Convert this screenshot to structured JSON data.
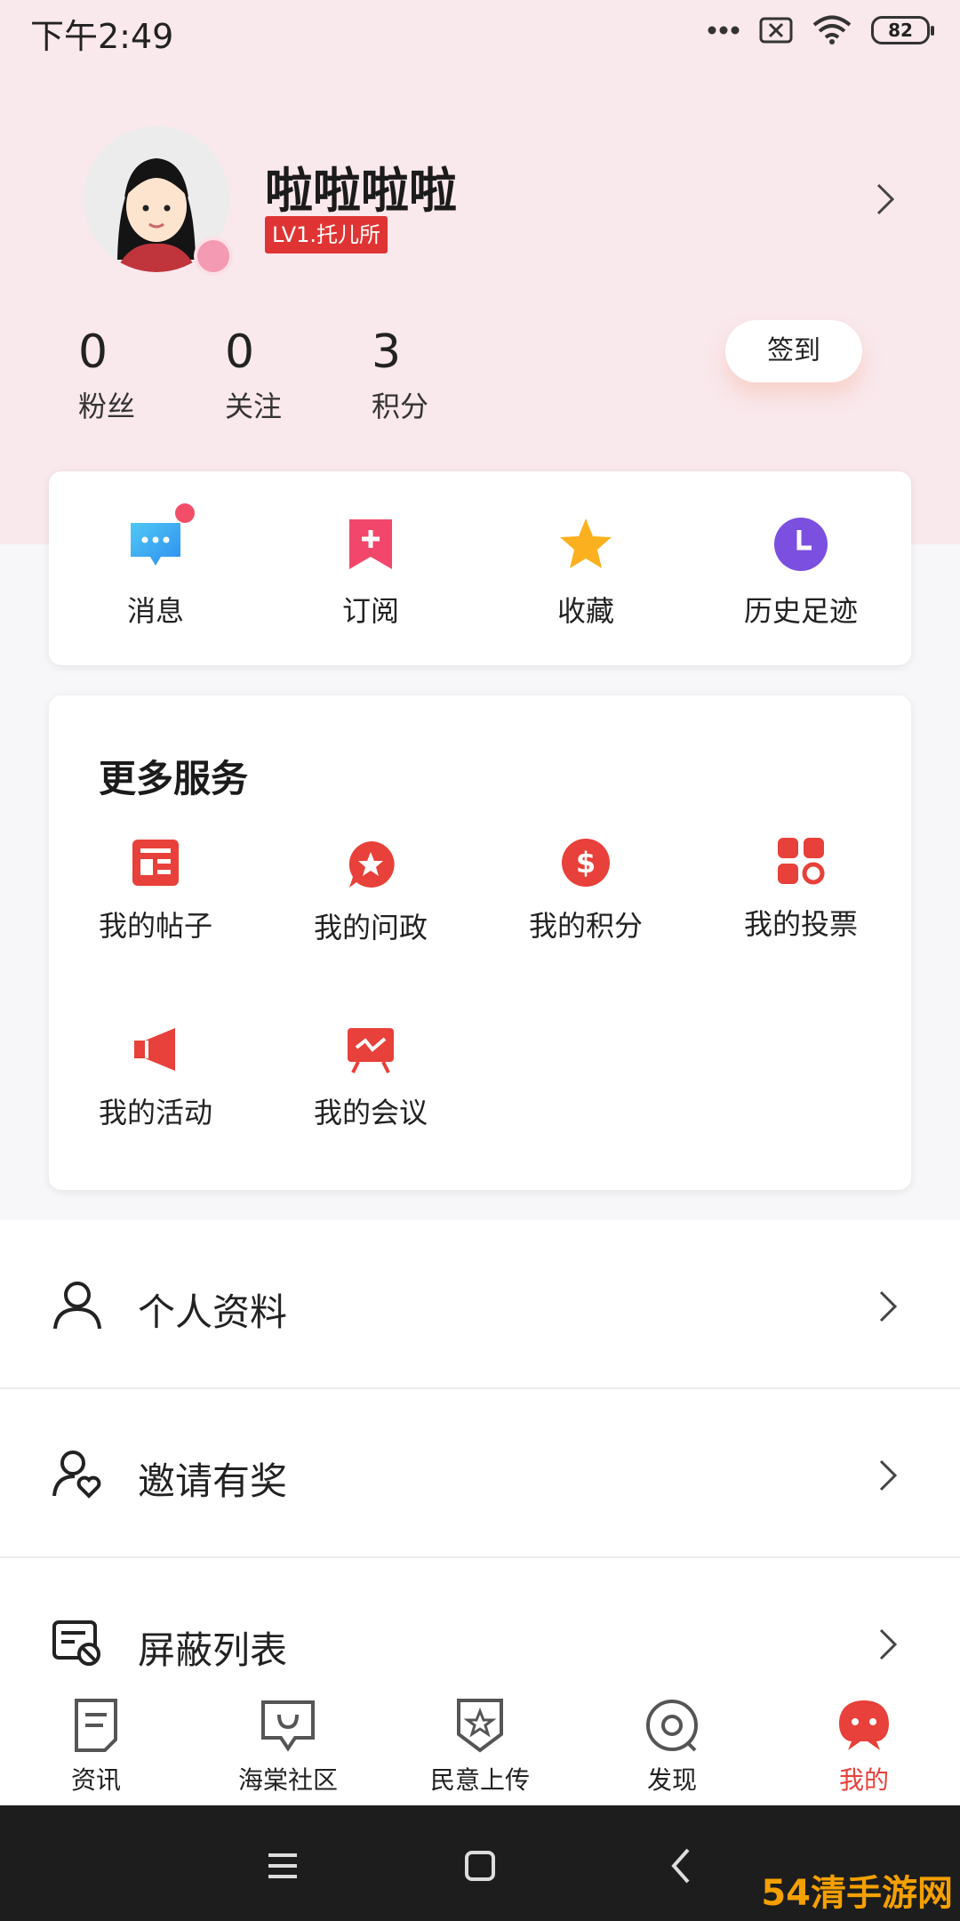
{
  "status_bar": {
    "time": "下午2:49",
    "battery": "82"
  },
  "profile": {
    "username": "啦啦啦啦",
    "level": "LV1.托儿所",
    "stats": [
      {
        "value": "0",
        "label": "粉丝"
      },
      {
        "value": "0",
        "label": "关注"
      },
      {
        "value": "3",
        "label": "积分"
      }
    ],
    "checkin_label": "签到"
  },
  "quick_actions": [
    {
      "label": "消息",
      "icon": "message-icon",
      "badge": true
    },
    {
      "label": "订阅",
      "icon": "subscribe-icon"
    },
    {
      "label": "收藏",
      "icon": "star-icon"
    },
    {
      "label": "历史足迹",
      "icon": "clock-icon"
    }
  ],
  "services": {
    "title": "更多服务",
    "items": [
      {
        "label": "我的帖子",
        "icon": "posts-icon"
      },
      {
        "label": "我的问政",
        "icon": "inquiry-icon"
      },
      {
        "label": "我的积分",
        "icon": "points-icon"
      },
      {
        "label": "我的投票",
        "icon": "vote-icon"
      },
      {
        "label": "我的活动",
        "icon": "activity-icon"
      },
      {
        "label": "我的会议",
        "icon": "meeting-icon"
      }
    ]
  },
  "menu": [
    {
      "label": "个人资料",
      "icon": "person-icon"
    },
    {
      "label": "邀请有奖",
      "icon": "invite-icon"
    },
    {
      "label": "屏蔽列表",
      "icon": "block-list-icon"
    }
  ],
  "tabs": [
    {
      "label": "资讯",
      "icon": "news-icon"
    },
    {
      "label": "海棠社区",
      "icon": "community-icon"
    },
    {
      "label": "民意上传",
      "icon": "upload-icon"
    },
    {
      "label": "发现",
      "icon": "discover-icon"
    },
    {
      "label": "我的",
      "icon": "mine-icon",
      "active": true
    }
  ],
  "watermark": "54清手游网",
  "colors": {
    "accent": "#e8403a",
    "top_bg": "#f9e8ec"
  }
}
